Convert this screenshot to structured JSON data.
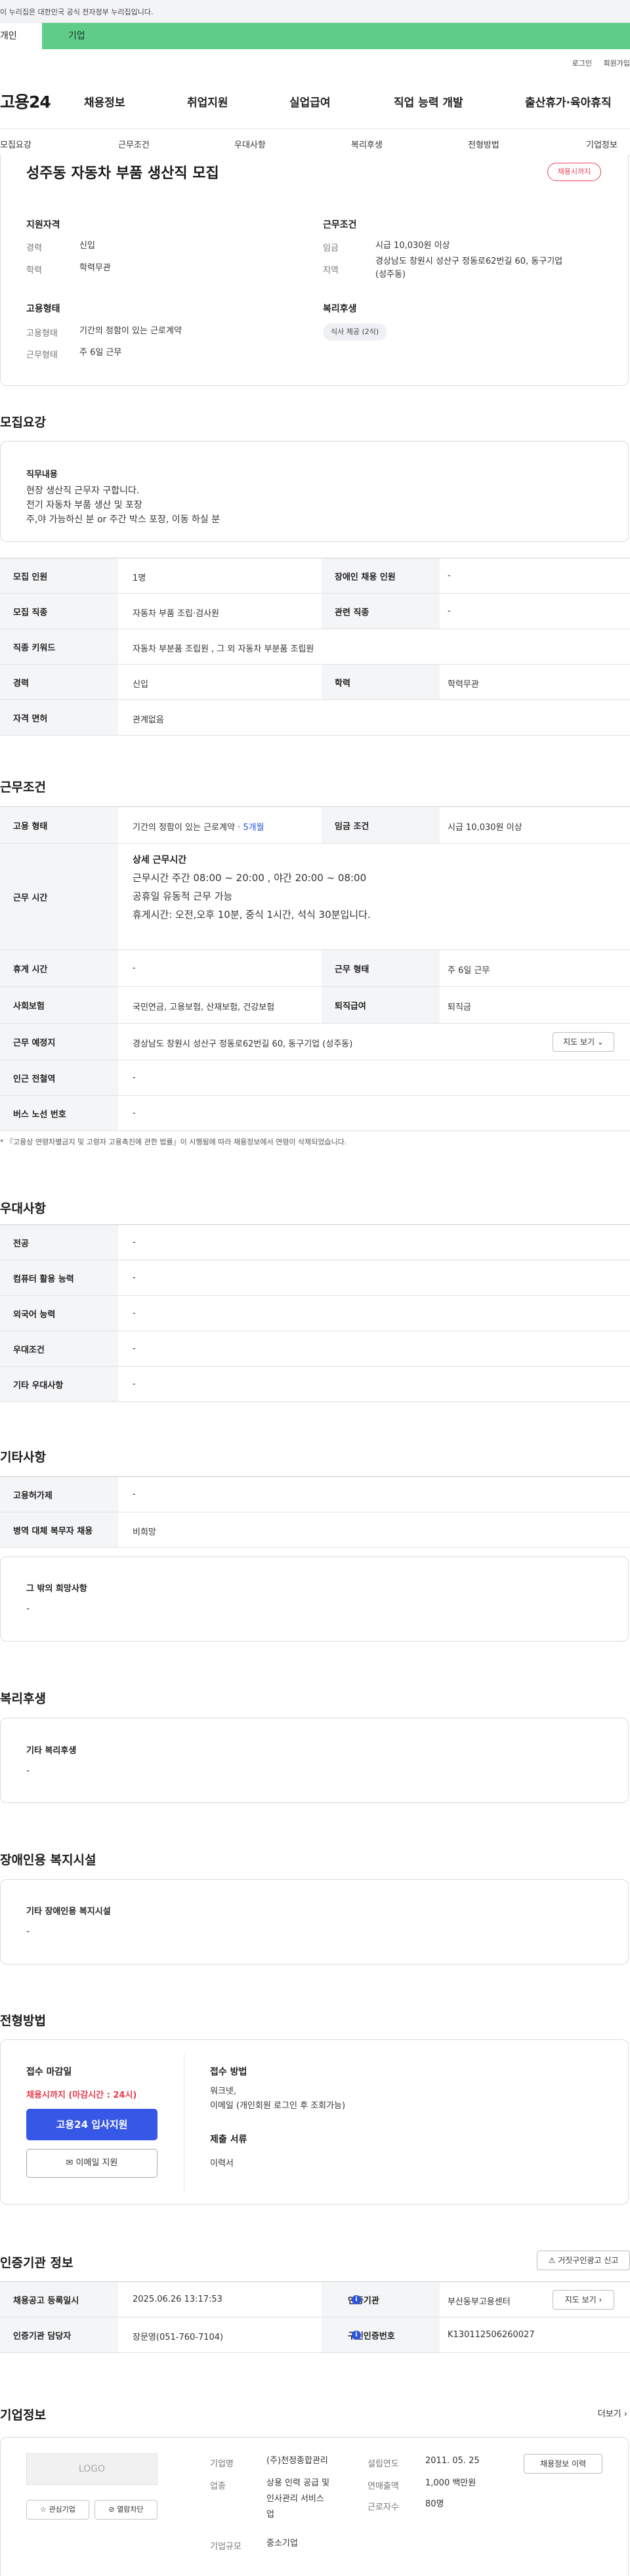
{
  "gov_banner": "이 누리집은 대한민국 공식 전자정부 누리집입니다.",
  "user_tabs": {
    "person": "개인",
    "company": "기업"
  },
  "util": {
    "login": "로그인",
    "signup": "회원가입"
  },
  "logo": "고용24",
  "gnb": [
    "채용정보",
    "취업지원",
    "실업급여",
    "직업 능력 개발",
    "출산휴가·육아휴직"
  ],
  "anchor_tabs": [
    "모집요강",
    "근무조건",
    "우대사항",
    "복리후생",
    "전형방법",
    "기업정보"
  ],
  "summary": {
    "title": "성주동 자동차 부품 생산직 모집",
    "deadline_badge": "채용시까지",
    "qual_heading": "지원자격",
    "career_label": "경력",
    "career_value": "신입",
    "edu_label": "학력",
    "edu_value": "학력무관",
    "emp_heading": "고용형태",
    "emp_label": "고용형태",
    "emp_value": "기간의 정함이 있는 근로계약",
    "workform_label": "근무형태",
    "workform_value": "주 6일 근무",
    "cond_heading": "근무조건",
    "wage_label": "임금",
    "wage_value": "시급 10,030원 이상",
    "area_label": "지역",
    "area_value_1": "경상남도 창원시 성산구 정동로62번길 60, 동구기업",
    "area_value_2": "(성주동)",
    "benefit_heading": "복리후생",
    "benefit_chip": "식사 제공 (2식)"
  },
  "recruit": {
    "section_title": "모집요강",
    "duty_heading": "직무내용",
    "duty_lines": [
      "현장 생산직 근무자 구합니다.",
      "전기 자동차 부품 생산 및 포장",
      "주,야 가능하신 분 or 주간 박스 포장, 이동 하실 분"
    ],
    "rows": [
      {
        "k1": "모집 인원",
        "v1": "1명",
        "k2": "장애인 채용 인원",
        "v2": "-"
      },
      {
        "k1": "모집 직종",
        "v1": "자동차 부품 조립·검사원",
        "k2": "관련 직종",
        "v2": "-"
      },
      {
        "k1": "직종 키워드",
        "v1": "자동차 부분품 조립원 , 그 외 자동차 부분품 조립원"
      },
      {
        "k1": "경력",
        "v1": "신입",
        "k2": "학력",
        "v2": "학력무관"
      },
      {
        "k1": "자격 면허",
        "v1": "관계없음"
      }
    ]
  },
  "conditions": {
    "section_title": "근무조건",
    "emp_k": "고용 형태",
    "emp_v": "기간의 정함이 있는 근로계약 · ",
    "emp_v_blue": "5개월",
    "wage_k": "임금 조건",
    "wage_v": "시급 10,030원 이상",
    "hours_k": "근무 시간",
    "hours_heading": "상세 근무시간",
    "hours_lines": [
      "근무시간 주간  08:00 ~ 20:00 , 야간 20:00 ~ 08:00",
      "공휴일 유동적 근무 가능",
      "휴게시간: 오전,오후 10분, 중식 1시간, 석식 30분입니다."
    ],
    "rest_k": "휴게 시간",
    "rest_v": "-",
    "workform_k": "근무 형태",
    "workform_v": "주 6일 근무",
    "insurance_k": "사회보험",
    "insurance_v": "국민연금, 고용보험, 산재보험, 건강보험",
    "severance_k": "퇴직급여",
    "severance_v": "퇴직금",
    "place_k": "근무 예정지",
    "place_v": "경상남도 창원시 성산구 정동로62번길 60, 동구기업 (성주동)",
    "map_button": "지도 보기",
    "subway_k": "인근 전철역",
    "subway_v": "-",
    "bus_k": "버스 노선 번호",
    "bus_v": "-",
    "note": "* 『고용상 연령차별금지 및 고령자 고용촉진에 관한 법률』이 시행됨에 따라 채용정보에서 연령이 삭제되었습니다."
  },
  "preferences": {
    "section_title": "우대사항",
    "rows": [
      {
        "k": "전공",
        "v": "-"
      },
      {
        "k": "컴퓨터 활용 능력",
        "v": "-"
      },
      {
        "k": "외국어 능력",
        "v": "-"
      },
      {
        "k": "우대조건",
        "v": "-"
      },
      {
        "k": "기타 우대사항",
        "v": "-"
      }
    ]
  },
  "etc": {
    "section_title": "기타사항",
    "rows": [
      {
        "k": "고용허가제",
        "v": "-"
      },
      {
        "k": "병역 대체 복무자 채용",
        "v": "비희망"
      }
    ],
    "other_heading": "그 밖의 희망사항",
    "other_value": "-"
  },
  "welfare": {
    "section_title": "복리후생",
    "heading": "기타 복리후생",
    "value": "-"
  },
  "disability": {
    "section_title": "장애인용 복지시설",
    "heading": "기타 장애인용 복지시설",
    "value": "-"
  },
  "apply": {
    "section_title": "전형방법",
    "deadline_heading": "접수 마감일",
    "deadline_value": "채용시까지 (마감시간 : 24시)",
    "apply_button": "고용24 입사지원",
    "email_button": "이메일 지원",
    "method_heading": "접수 방법",
    "method_lines": [
      "워크넷,",
      "이메일 (개인회원 로그인 후 조회가능)"
    ],
    "docs_heading": "제출 서류",
    "docs_value": "이력서"
  },
  "agency": {
    "section_title": "인증기관 정보",
    "report_button": "거짓구인광고 신고",
    "reg_k": "채용공고 등록일시",
    "reg_v": "2025.06.26 13:17:53",
    "cert_k": "인증기관",
    "cert_v": "부산동부고용센터",
    "map_button": "지도 보기",
    "manager_k": "인증기관 담당자",
    "manager_v": "장문영(051-760-7104)",
    "certno_k": "구인인증번호",
    "certno_v": "K130112506260027"
  },
  "company": {
    "section_title": "기업정보",
    "more": "더보기",
    "logo_placeholder": "LOGO",
    "interest_button": "관심기업",
    "block_button": "열람차단",
    "name_k": "기업명",
    "name_v": "(주)천정종합관리",
    "industry_k": "업종",
    "industry_lines": [
      "상용 인력 공급 및",
      "인사관리 서비스",
      "업"
    ],
    "size_k": "기업규모",
    "size_v": "중소기업",
    "founded_k": "설립연도",
    "founded_v": "2011. 05. 25",
    "sales_k": "연매출액",
    "sales_v": "1,000 백만원",
    "staff_k": "근로자수",
    "staff_v": "80명",
    "history_button": "채용정보 이력"
  }
}
